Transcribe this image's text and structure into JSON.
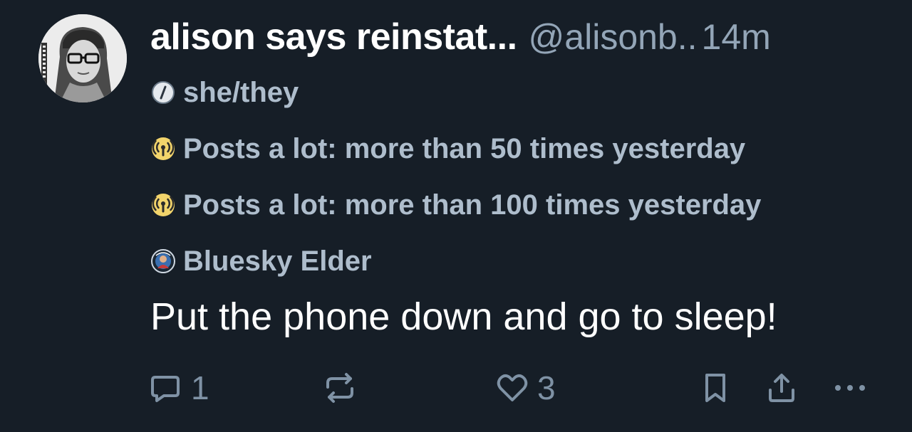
{
  "post": {
    "author": {
      "display_name": "alison says reinstat...",
      "handle": "@alisonb..",
      "time": "14m"
    },
    "labels": [
      {
        "icon": "pronouns-icon",
        "text": "she/they"
      },
      {
        "icon": "broadcast-icon",
        "text": "Posts a lot: more than 50 times yesterday"
      },
      {
        "icon": "broadcast-icon",
        "text": "Posts a lot: more than 100 times yesterday"
      },
      {
        "icon": "elder-badge-icon",
        "text": "Bluesky Elder"
      }
    ],
    "text": "Put the phone down and go to sleep!",
    "actions": {
      "reply_count": "1",
      "like_count": "3"
    }
  },
  "colors": {
    "background": "#161e27",
    "primary_text": "#ffffff",
    "secondary_text": "#93a5b7",
    "label_text": "#aebdcc",
    "action_icon": "#7f92a5",
    "broadcast_badge": "#f2d46b"
  }
}
